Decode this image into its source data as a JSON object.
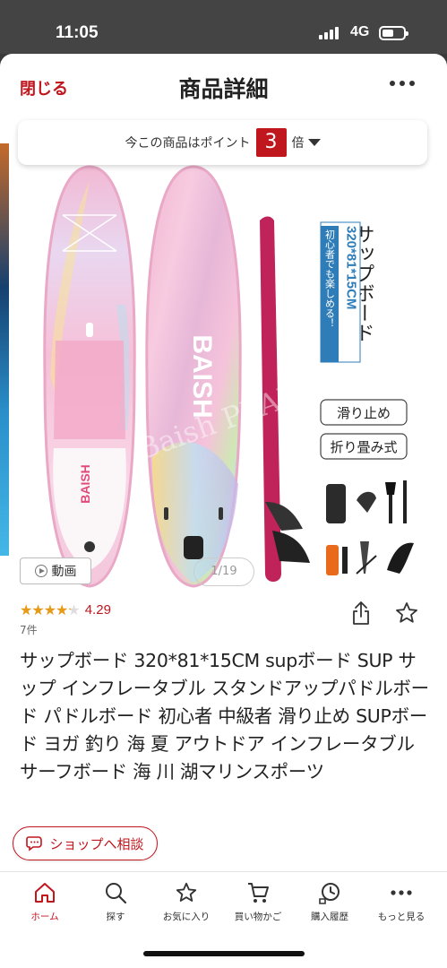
{
  "status_bar": {
    "time": "11:05",
    "network": "4G"
  },
  "header": {
    "close_label": "閉じる",
    "title": "商品詳細"
  },
  "points_banner": {
    "prefix": "今この商品はポイント",
    "multiplier": "3",
    "suffix": "倍"
  },
  "image_text": {
    "vertical_title": "サップボード",
    "spec_tag": "320*81*15CM",
    "spec_sub": "初心者でも楽しめる！",
    "feature_1": "滑り止め",
    "feature_2": "折り畳み式",
    "board_brand": "BAISH",
    "watermark": "Baish PLAN"
  },
  "media": {
    "video_label": "動画",
    "page_indicator": "1/19"
  },
  "rating": {
    "stars": "★★★★★",
    "value": "4.29",
    "value_fraction": 0.858,
    "review_count": "7件"
  },
  "product": {
    "title": "サップボード 320*81*15CM supボード SUP サップ インフレータブル スタンドアップパドルボード パドルボード 初心者 中級者 滑り止め SUPボード ヨガ 釣り 海 夏 アウトドア インフレータブル サーフボード 海 川 湖マリンスポーツ"
  },
  "consult": {
    "label": "ショップへ相談"
  },
  "tabbar": {
    "items": [
      {
        "label": "ホーム",
        "icon": "home-icon"
      },
      {
        "label": "探す",
        "icon": "search-icon"
      },
      {
        "label": "お気に入り",
        "icon": "star-icon"
      },
      {
        "label": "買い物かご",
        "icon": "cart-icon"
      },
      {
        "label": "購入履歴",
        "icon": "history-icon"
      },
      {
        "label": "もっと見る",
        "icon": "more-icon"
      }
    ]
  },
  "colors": {
    "accent": "#c0161e",
    "star": "#e89a17"
  }
}
